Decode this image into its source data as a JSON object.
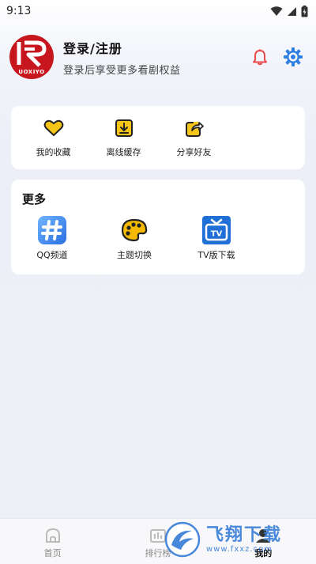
{
  "status_bar": {
    "time": "9:13"
  },
  "profile": {
    "avatar_brand": "UOXIYO",
    "login_label": "登录/注册",
    "subtitle": "登录后享受更多看剧权益"
  },
  "tools": [
    {
      "label": "我的收藏",
      "icon": "heart-icon"
    },
    {
      "label": "离线缓存",
      "icon": "download-icon"
    },
    {
      "label": "分享好友",
      "icon": "share-icon"
    }
  ],
  "more": {
    "title": "更多",
    "items": [
      {
        "label": "QQ频道",
        "icon": "qq-channel-icon"
      },
      {
        "label": "主题切换",
        "icon": "palette-icon"
      },
      {
        "label": "TV版下载",
        "icon": "tv-icon"
      }
    ]
  },
  "bottom_nav": [
    {
      "label": "首页",
      "icon": "home-icon",
      "active": false
    },
    {
      "label": "排行榜",
      "icon": "ranking-icon",
      "active": false
    },
    {
      "label": "我的",
      "icon": "profile-icon",
      "active": true
    }
  ],
  "watermark": {
    "text": "飞翔下载",
    "url": "www.fxxz.com"
  },
  "colors": {
    "accent": "#3a7fd8",
    "avatar_red": "#c8161e",
    "bell": "#e84a4a",
    "gear": "#2f7fe0",
    "heart_yellow": "#f5c518"
  }
}
